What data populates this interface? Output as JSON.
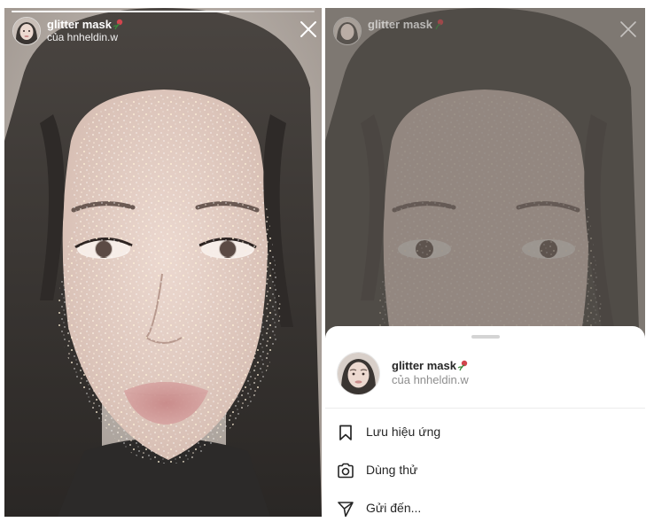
{
  "story": {
    "effect_name": "glitter mask",
    "creator": "của hnheldin.w",
    "progress": 0.72
  },
  "sheet": {
    "effect_name": "glitter mask",
    "creator": "của hnheldin.w",
    "menu": [
      {
        "label": "Lưu hiệu ứng",
        "icon": "bookmark-icon"
      },
      {
        "label": "Dùng thử",
        "icon": "camera-icon"
      },
      {
        "label": "Gửi đến...",
        "icon": "send-icon"
      }
    ]
  },
  "icons": {
    "effect_emoji": "rose-icon",
    "close": "close-icon"
  },
  "colors": {
    "overlay": "#605b56",
    "sheet_background": "#ffffff",
    "primary_text": "#262626",
    "secondary_text": "#8e8e8e",
    "glitter": "#fff7e6"
  }
}
